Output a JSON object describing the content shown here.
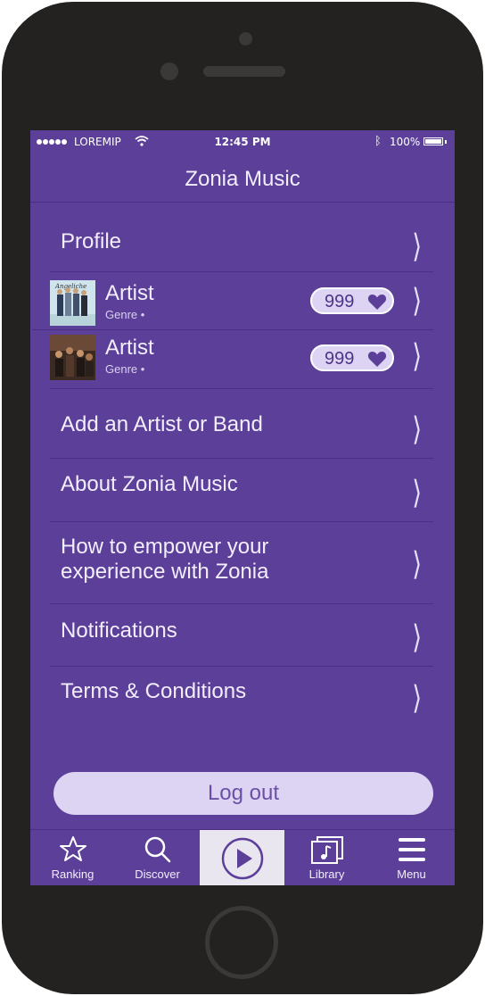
{
  "status": {
    "carrier": "LOREMIP",
    "time": "12:45 PM",
    "battery": "100%"
  },
  "app": {
    "title": "Zonia Music"
  },
  "menu": {
    "profile": "Profile",
    "artists": [
      {
        "name": "Artist",
        "genre": "Genre •",
        "count": "999"
      },
      {
        "name": "Artist",
        "genre": "Genre •",
        "count": "999"
      }
    ],
    "items": [
      "Add an Artist or Band",
      "About Zonia Music",
      "How to empower your experience with Zonia",
      "Notifications",
      "Terms & Conditions"
    ],
    "logout": "Log out"
  },
  "tabs": [
    {
      "label": "Ranking",
      "icon": "star-icon"
    },
    {
      "label": "Discover",
      "icon": "search-icon"
    },
    {
      "label": "",
      "icon": "play-icon"
    },
    {
      "label": "Library",
      "icon": "music-library-icon"
    },
    {
      "label": "Menu",
      "icon": "hamburger-menu-icon"
    }
  ],
  "colors": {
    "background": "#5c3f99",
    "pill": "#ddd4f3",
    "accent": "#4e3488"
  }
}
